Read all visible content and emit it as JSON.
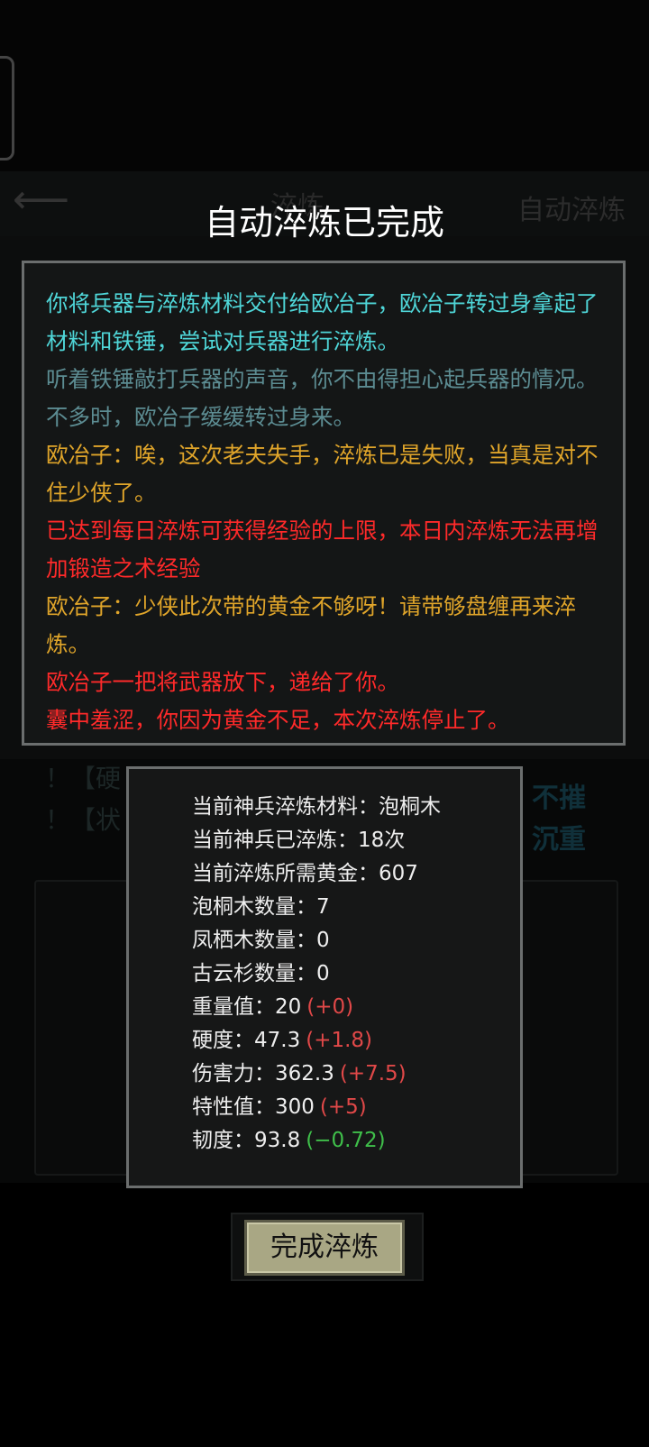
{
  "background": {
    "header_title": "淬炼",
    "auto_label": "自动淬炼",
    "tags": [
      "！【硬",
      "！【状"
    ],
    "tags_right": [
      "不摧",
      "沉重"
    ]
  },
  "dialog": {
    "title": "自动淬炼已完成",
    "log": [
      {
        "text": "你将兵器与淬炼材料交付给欧冶子，欧冶子转过身拿起了材料和铁锤，尝试对兵器进行淬炼。",
        "color": "#4fd6d8"
      },
      {
        "text": "听着铁锤敲打兵器的声音，你不由得担心起兵器的情况。不多时，欧冶子缓缓转过身来。",
        "color": "#5c8c92"
      },
      {
        "text": "欧冶子：唉，这次老夫失手，淬炼已是失败，当真是对不住少侠了。",
        "color": "#e0a52a"
      },
      {
        "text": "已达到每日淬炼可获得经验的上限，本日内淬炼无法再增加锻造之术经验",
        "color": "#ff2a2a"
      },
      {
        "text": "欧冶子：少侠此次带的黄金不够呀！请带够盘缠再来淬炼。",
        "color": "#e0a52a"
      },
      {
        "text": "欧冶子一把将武器放下，递给了你。",
        "color": "#ff2a2a"
      },
      {
        "text": "囊中羞涩，你因为黄金不足，本次淬炼停止了。",
        "color": "#ff2a2a"
      }
    ]
  },
  "stats": [
    {
      "label": "当前神兵淬炼材料：",
      "value": "泡桐木",
      "delta": ""
    },
    {
      "label": "当前神兵已淬炼：",
      "value": "18次",
      "delta": ""
    },
    {
      "label": "当前淬炼所需黄金：",
      "value": "607",
      "delta": ""
    },
    {
      "label": "泡桐木数量：",
      "value": "7",
      "delta": ""
    },
    {
      "label": "凤栖木数量：",
      "value": "0",
      "delta": ""
    },
    {
      "label": "古云杉数量：",
      "value": "0",
      "delta": ""
    },
    {
      "label": "重量值：",
      "value": "20",
      "delta": "(+0)",
      "delta_color": "#e04848"
    },
    {
      "label": "硬度：",
      "value": "47.3",
      "delta": "(+1.8)",
      "delta_color": "#e04848"
    },
    {
      "label": "伤害力：",
      "value": "362.3",
      "delta": "(+7.5)",
      "delta_color": "#e04848"
    },
    {
      "label": "特性值：",
      "value": "300",
      "delta": "(+5)",
      "delta_color": "#e04848"
    },
    {
      "label": "韧度：",
      "value": "93.8",
      "delta": "(−0.72)",
      "delta_color": "#3fbf4a"
    }
  ],
  "button": {
    "label": "完成淬炼"
  }
}
